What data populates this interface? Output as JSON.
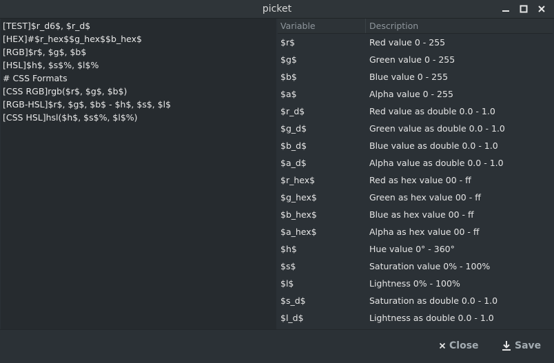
{
  "window": {
    "title": "picket",
    "controls": [
      "minimize-icon",
      "maximize-icon",
      "close-icon"
    ]
  },
  "editor": {
    "lines": [
      "[TEST]$r_d6$, $r_d$",
      "[HEX]#$r_hex$$g_hex$$b_hex$",
      "[RGB]$r$, $g$, $b$",
      "[HSL]$h$, $s$%, $l$%",
      "# CSS Formats",
      "[CSS RGB]rgb($r$, $g$, $b$)",
      "[RGB-HSL]$r$, $g$, $b$ - $h$, $s$, $l$",
      "[CSS HSL]hsl($h$, $s$%, $l$%)"
    ]
  },
  "table": {
    "headers": {
      "variable": "Variable",
      "description": "Description"
    },
    "rows": [
      {
        "variable": "$r$",
        "description": "Red value 0 - 255"
      },
      {
        "variable": "$g$",
        "description": "Green value 0 - 255"
      },
      {
        "variable": "$b$",
        "description": "Blue value 0 - 255"
      },
      {
        "variable": "$a$",
        "description": "Alpha value 0 - 255"
      },
      {
        "variable": "$r_d$",
        "description": "Red value as double 0.0 - 1.0"
      },
      {
        "variable": "$g_d$",
        "description": "Green value as double 0.0 - 1.0"
      },
      {
        "variable": "$b_d$",
        "description": "Blue value as double 0.0 - 1.0"
      },
      {
        "variable": "$a_d$",
        "description": "Alpha value as double 0.0 - 1.0"
      },
      {
        "variable": "$r_hex$",
        "description": "Red as hex value 00 - ff"
      },
      {
        "variable": "$g_hex$",
        "description": "Green as hex value 00 - ff"
      },
      {
        "variable": "$b_hex$",
        "description": "Blue as hex value 00 - ff"
      },
      {
        "variable": "$a_hex$",
        "description": "Alpha as hex value 00 - ff"
      },
      {
        "variable": "$h$",
        "description": "Hue value 0° -  360°"
      },
      {
        "variable": "$s$",
        "description": "Saturation value 0% - 100%"
      },
      {
        "variable": "$l$",
        "description": "Lightness 0% - 100%"
      },
      {
        "variable": "$s_d$",
        "description": "Saturation as double 0.0 - 1.0"
      },
      {
        "variable": "$l_d$",
        "description": "Lightness as double 0.0 - 1.0"
      }
    ]
  },
  "footer": {
    "close_label": "Close",
    "close_icon": "close-icon",
    "save_label": "Save",
    "save_icon": "download-icon"
  },
  "colors": {
    "background": "#2b3136",
    "editor_background": "#262b2f",
    "text": "#e6e6e6",
    "header_text": "#8e969c",
    "button_text": "#a4adb3"
  }
}
